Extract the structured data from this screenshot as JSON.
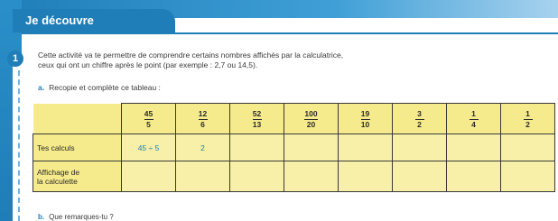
{
  "section": {
    "title": "Je découvre"
  },
  "activity": {
    "number": "1",
    "intro_line1": "Cette activité va te permettre de comprendre certains nombres affichés par la calculatrice,",
    "intro_line2": "ceux qui ont un chiffre après le point (par exemple : 2,7 ou 14,5).",
    "question_a_letter": "a.",
    "question_a_text": "Recopie et complète ce tableau :",
    "question_b_letter": "b.",
    "question_b_text": "Que remarques-tu ?"
  },
  "table": {
    "fractions": [
      {
        "num": "45",
        "den": "5"
      },
      {
        "num": "12",
        "den": "6"
      },
      {
        "num": "52",
        "den": "13"
      },
      {
        "num": "100",
        "den": "20"
      },
      {
        "num": "19",
        "den": "10"
      },
      {
        "num": "3",
        "den": "2"
      },
      {
        "num": "1",
        "den": "4"
      },
      {
        "num": "1",
        "den": "2"
      }
    ],
    "row1_label": "Tes calculs",
    "row2_label_line1": "Affichage de",
    "row2_label_line2": "la calculette",
    "row1_values": [
      "45 ÷ 5",
      "2",
      "",
      "",
      "",
      "",
      "",
      ""
    ],
    "row2_values": [
      "",
      "",
      "",
      "",
      "",
      "",
      "",
      ""
    ]
  }
}
